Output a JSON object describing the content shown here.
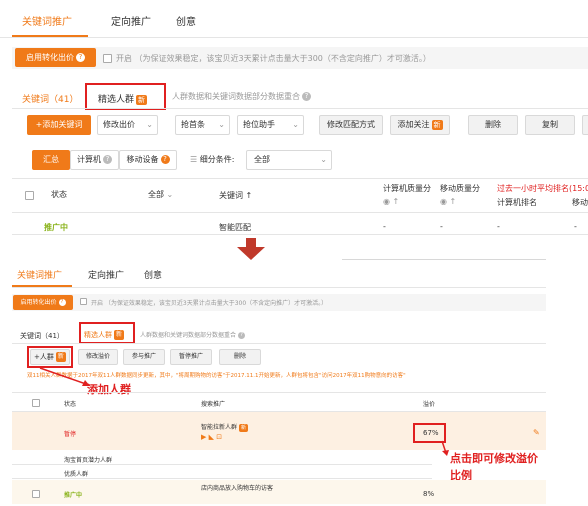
{
  "top": {
    "tabs": [
      "关键词推广",
      "定向推广",
      "创意"
    ],
    "conv_btn": "启用转化出价",
    "conv_note": "开启 （为保证效果稳定，该宝贝近3天累计点击量大于300（不含定向推广）才可激活。）",
    "subtabs": [
      "关键词（41）",
      "精选人群"
    ],
    "new_badge": "新",
    "hint": "人群数据和关键词数据部分数据重合",
    "toolbar": [
      "+添加关键词",
      "修改出价",
      "抢首条",
      "抢位助手",
      "修改匹配方式",
      "添加关注",
      "删除",
      "复制"
    ],
    "filters": [
      "汇总",
      "计算机",
      "移动设备"
    ],
    "seg_label": "细分条件:",
    "seg_value": "全部",
    "headers": [
      "状态",
      "全部",
      "关键词",
      "计算机质量分",
      "移动质量分",
      "过去一小时平均排名(15:0",
      "计算机排名",
      "移动"
    ],
    "row": {
      "status": "推广中",
      "keyword": "智能匹配",
      "c1": "-",
      "c2": "-",
      "c3": "-",
      "c4": "-"
    }
  },
  "bottom": {
    "tabs": [
      "关键词推广",
      "定向推广",
      "创意"
    ],
    "conv_btn": "启用转化出价",
    "conv_note": "开启 （为保证效果稳定，该宝贝近3天累计点击量大于300（不含定向推广）才可激活。）",
    "subtabs": [
      "关键词（41）",
      "精选人群"
    ],
    "new_badge": "新",
    "hint": "人群数据和关键词数据部分数据重合",
    "toolbar": [
      "+人群",
      "修改溢价",
      "参与推广",
      "暂停推广",
      "删除"
    ],
    "notice": "双11相关人群数据于2017年双11人群数据同步更新，其中，\"将周期购物的访客\"于2017.11.1开始更新，人群包将包含\"访问2017年双11购物意向的访客\"",
    "headers": [
      "状态",
      "搜索推广",
      "溢价"
    ],
    "row1": {
      "status": "暂停",
      "name": "智能拉新人群",
      "pct": "67%"
    },
    "group1": "淘宝首页潜力人群",
    "group2": "优质人群",
    "row2": {
      "status": "推广中",
      "name": "店内商品放入购物车的访客",
      "pct": "8%"
    }
  },
  "annotations": {
    "add_crowd": "添加人群",
    "modify_premium_line1": "点击即可修改溢价",
    "modify_premium_line2": "比例"
  },
  "colors": {
    "accent": "#f07a19",
    "annotation": "#e02020",
    "active_status": "#8ab31c"
  }
}
